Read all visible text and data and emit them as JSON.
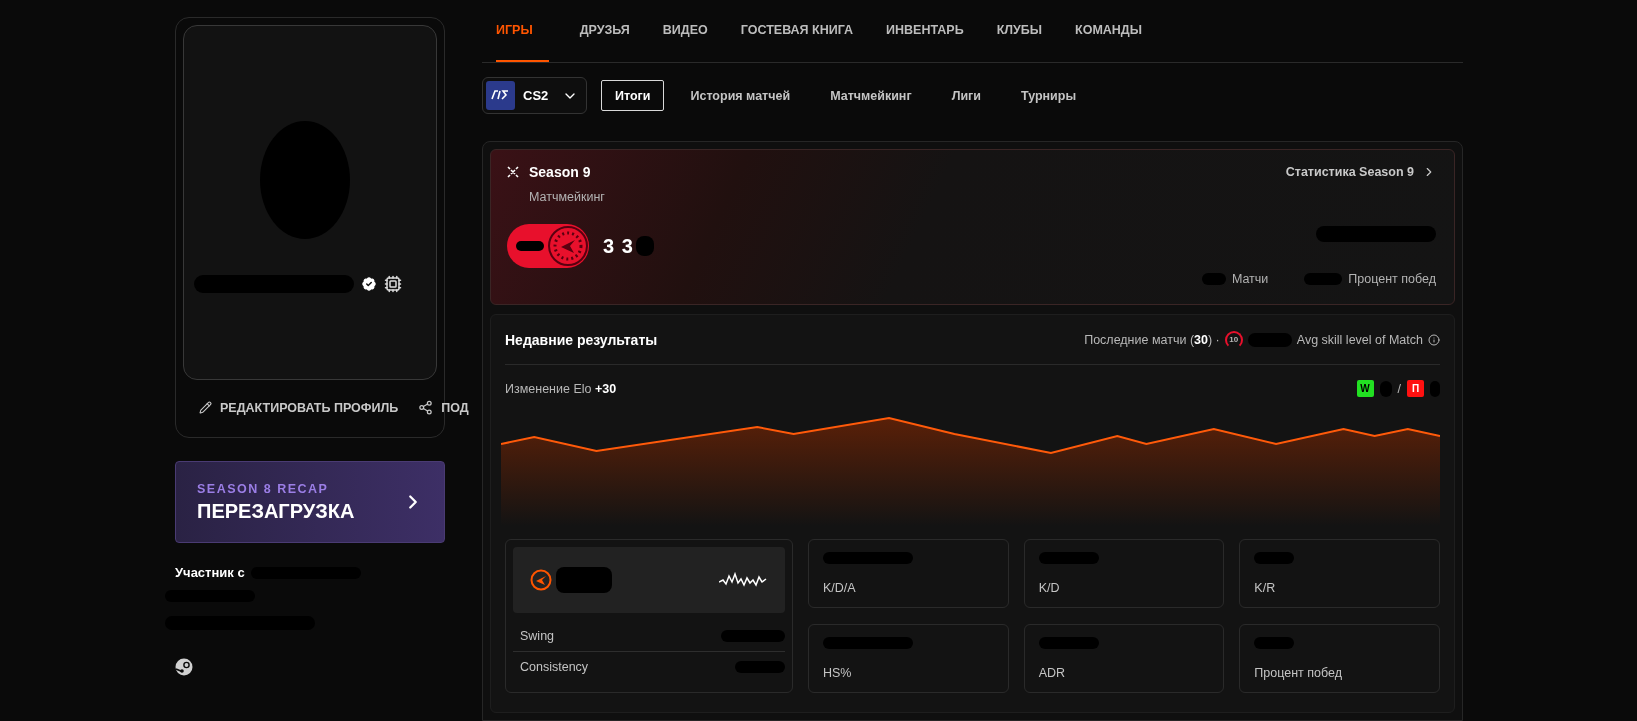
{
  "profile": {
    "edit_label": "РЕДАКТИРОВАТЬ ПРОФИЛЬ",
    "share_label": "ПОД"
  },
  "recap": {
    "kicker": "SEASON 8 RECAP",
    "title": "ПЕРЕЗАГРУЗКА"
  },
  "member_since": "Участник с",
  "nav_tabs": [
    {
      "label": "ИГРЫ",
      "selected": true
    },
    {
      "label": "ДРУЗЬЯ",
      "selected": false
    },
    {
      "label": "ВИДЕО",
      "selected": false
    },
    {
      "label": "ГОСТЕВАЯ КНИГА",
      "selected": false
    },
    {
      "label": "ИНВЕНТАРЬ",
      "selected": false
    },
    {
      "label": "КЛУБЫ",
      "selected": false
    },
    {
      "label": "КОМАНДЫ",
      "selected": false
    }
  ],
  "game_select": {
    "value": "CS2"
  },
  "sub_tabs": [
    {
      "label": "Итоги",
      "selected": true
    },
    {
      "label": "История матчей",
      "selected": false
    },
    {
      "label": "Матчмейкинг",
      "selected": false
    },
    {
      "label": "Лиги",
      "selected": false
    },
    {
      "label": "Турниры",
      "selected": false
    }
  ],
  "season": {
    "title": "Season 9",
    "subtitle": "Матчмейкинг",
    "link": "Статистика Season 9",
    "elo": "3 3",
    "matches_label": "Матчи",
    "winrate_label": "Процент побед"
  },
  "recent": {
    "title": "Недавние результаты",
    "last_matches": "Последние матчи (**30**) ·",
    "level": "10",
    "avg_label": "Avg skill level of Match",
    "elo_change": "Изменение Elo **+30**",
    "win_mark": "W",
    "slash": "/",
    "loss_mark": "П"
  },
  "skill": {
    "rows": [
      "Swing",
      "Consistency"
    ]
  },
  "stats": [
    {
      "label": "K/D/A"
    },
    {
      "label": "K/D"
    },
    {
      "label": "K/R"
    },
    {
      "label": "HS%"
    },
    {
      "label": "ADR"
    },
    {
      "label": "Процент побед"
    }
  ]
}
